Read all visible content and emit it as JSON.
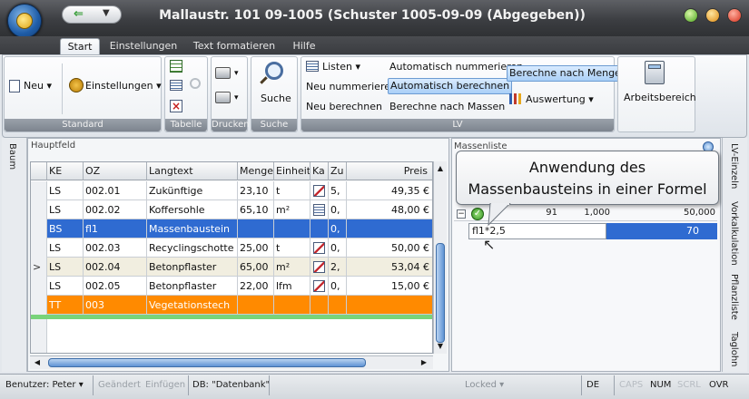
{
  "window": {
    "title": "Mallaustr. 101 09-1005 (Schuster 1005-09-09 (Abgegeben))"
  },
  "ribbon_tabs": [
    "Start",
    "Einstellungen",
    "Text formatieren",
    "Hilfe"
  ],
  "ribbon": {
    "standard": {
      "new_label": "Neu",
      "settings_label": "Einstellungen",
      "group_label": "Standard"
    },
    "tabelle": {
      "group_label": "Tabelle"
    },
    "drucken": {
      "group_label": "Drucken"
    },
    "suche": {
      "button_label": "Suche",
      "group_label": "Suche"
    },
    "lv": {
      "listen_label": "Listen",
      "neu_nummerieren": "Neu nummerieren",
      "neu_berechnen": "Neu berechnen",
      "auto_nummerieren": "Automatisch nummerieren",
      "auto_berechnen": "Automatisch berechnen",
      "berechne_massen": "Berechne nach Massen",
      "berechne_menge": "Berechne nach Menge",
      "auswertung": "Auswertung",
      "group_label": "LV"
    },
    "arbeitsbereich": {
      "label": "Arbeitsbereich"
    }
  },
  "left_strip": {
    "label": "Baum"
  },
  "hauptfeld": {
    "label": "Hauptfeld",
    "columns": [
      "KE",
      "OZ",
      "Langtext",
      "Menge",
      "Einheit",
      "Ka",
      "Zu",
      "Preis"
    ],
    "rows": [
      {
        "ke": "LS",
        "oz": "002.01",
        "langtext": "Zukünftige",
        "menge": "23,10",
        "einheit": "t",
        "ka": "pen",
        "zu": "5,",
        "preis": "49,35 €",
        "style": "normal"
      },
      {
        "ke": "LS",
        "oz": "002.02",
        "langtext": "Koffersohle",
        "menge": "65,10",
        "einheit": "m²",
        "ka": "calc",
        "zu": "0,",
        "preis": "48,00 €",
        "style": "normal"
      },
      {
        "ke": "BS",
        "oz": "fl1",
        "langtext": "Massenbaustein",
        "menge": "",
        "einheit": "",
        "ka": "",
        "zu": "0,",
        "preis": "",
        "style": "selected"
      },
      {
        "ke": "LS",
        "oz": "002.03",
        "langtext": "Recyclingschotte",
        "menge": "25,00",
        "einheit": "t",
        "ka": "pen",
        "zu": "0,",
        "preis": "50,00 €",
        "style": "normal"
      },
      {
        "ke": "LS",
        "oz": "002.04",
        "langtext": "Betonpflaster",
        "menge": "65,00",
        "einheit": "m²",
        "ka": "pen",
        "zu": "2,",
        "preis": "53,04 €",
        "style": "current"
      },
      {
        "ke": "LS",
        "oz": "002.05",
        "langtext": "Betonpflaster",
        "menge": "22,00",
        "einheit": "lfm",
        "ka": "pen",
        "zu": "0,",
        "preis": "15,00 €",
        "style": "normal"
      },
      {
        "ke": "TT",
        "oz": "003",
        "langtext": "Vegetationstech",
        "menge": "",
        "einheit": "",
        "ka": "",
        "zu": "",
        "preis": "",
        "style": "orange"
      }
    ],
    "current_row_marker": ">"
  },
  "massenliste": {
    "header_fragment": "Massenliste",
    "row": {
      "value1": "91",
      "value2": "1,000",
      "value3": "50,000"
    },
    "formula": "fl1*2,5",
    "formula_result": "70"
  },
  "tooltip": {
    "line1": "Anwendung des",
    "line2": "Massenbausteins in einer Formel"
  },
  "right_tabs": [
    "LV-Einzeln",
    "Vorkalkulation",
    "Pflanzliste",
    "Taglohn"
  ],
  "statusbar": {
    "user": "Benutzer: Peter",
    "geaendert": "Geändert",
    "einfuegen": "Einfügen",
    "db": "DB: \"Datenbank\"",
    "locked": "Locked",
    "lang": "DE",
    "caps": "CAPS",
    "num": "NUM",
    "scrl": "SCRL",
    "ovr": "OVR"
  },
  "colors": {
    "selected_row": "#2f6bd1",
    "orange_row": "#ff8a00",
    "current_row": "#f1eee0",
    "tooltip_border": "#6f7780"
  }
}
